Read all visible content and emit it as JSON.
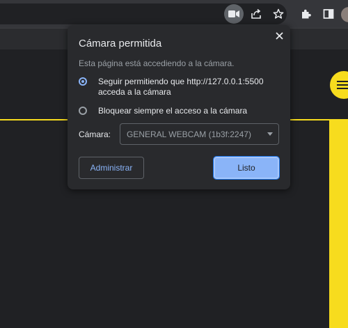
{
  "browser": {
    "toolbar_icons": [
      "camera-icon",
      "share-icon",
      "star-icon",
      "extensions-icon",
      "side-panel-icon"
    ]
  },
  "popup": {
    "title": "Cámara permitida",
    "subtitle": "Esta página está accediendo a la cámara.",
    "options": [
      {
        "label_line1": "Seguir permitiendo que http://127.0.0.1:5500",
        "label_line2": "acceda a la cámara",
        "checked": true
      },
      {
        "label_line1": "Bloquear siempre el acceso a la cámara",
        "label_line2": "",
        "checked": false
      }
    ],
    "camera_label": "Cámara:",
    "camera_selected": "GENERAL WEBCAM (1b3f:2247)",
    "manage_button": "Administrar",
    "done_button": "Listo"
  },
  "colors": {
    "accent": "#8ab4f8",
    "brand_yellow": "#f7dc1e",
    "background": "#202124",
    "popup_bg": "#292a2d"
  }
}
